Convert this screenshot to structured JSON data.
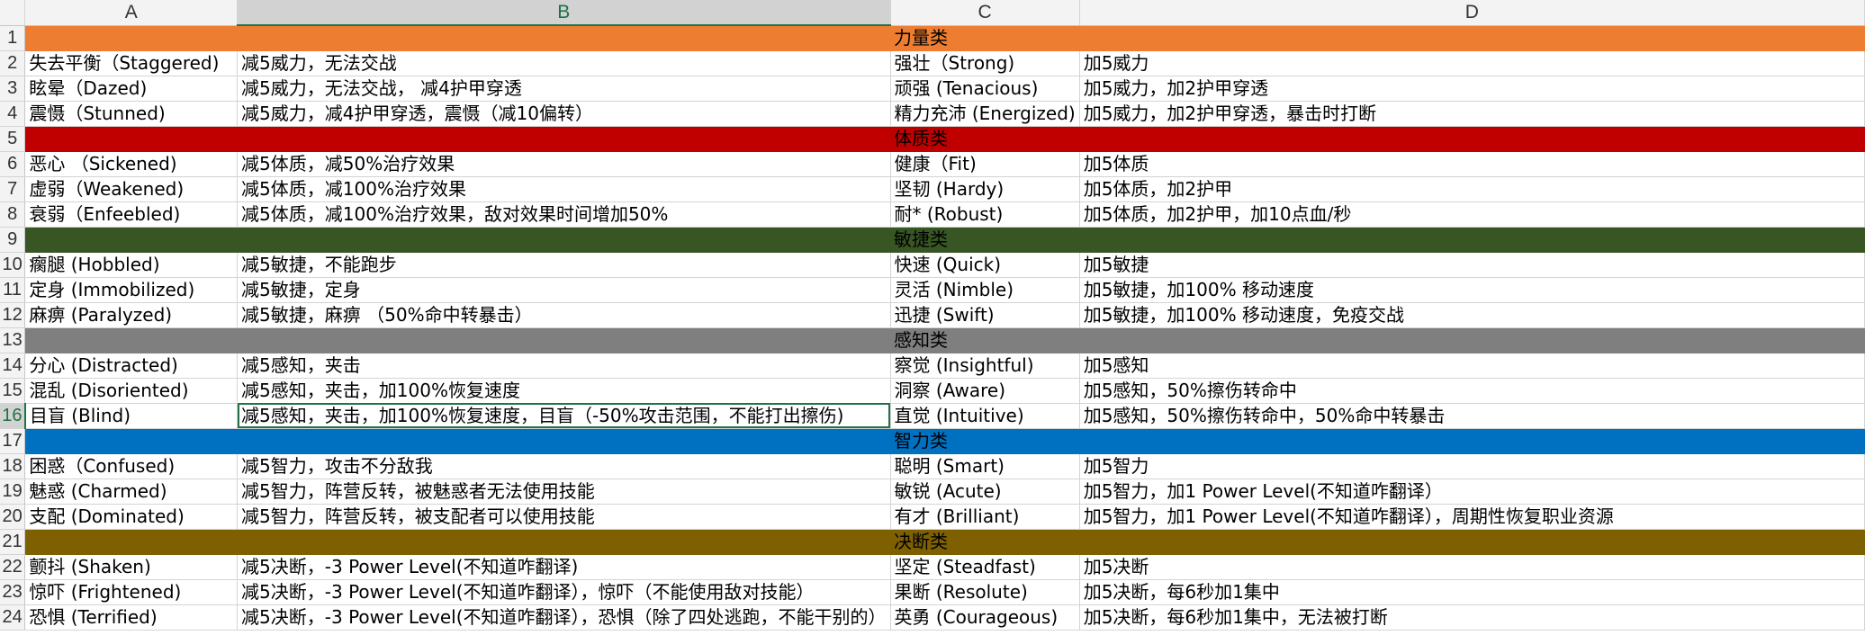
{
  "column_headers": [
    "A",
    "B",
    "C",
    "D"
  ],
  "selected_column": "B",
  "selected_row": "16",
  "colors": {
    "力量类": "#ed7d31",
    "体质类": "#c00000",
    "敏捷类": "#375623",
    "感知类": "#7f7f7f",
    "智力类": "#0070c0",
    "决断类": "#7f6000"
  },
  "rows": [
    {
      "n": "1",
      "band": true,
      "title": "力量类"
    },
    {
      "n": "2",
      "a": "失去平衡（Staggered)",
      "b": "减5威力，无法交战",
      "c": "强壮（Strong)",
      "d": "加5威力"
    },
    {
      "n": "3",
      "a": "眩晕（Dazed)",
      "b": "减5威力，无法交战， 减4护甲穿透",
      "c": "顽强 (Tenacious)",
      "d": "加5威力，加2护甲穿透"
    },
    {
      "n": "4",
      "a": "震慑（Stunned)",
      "b": "减5威力，减4护甲穿透，震慑（减10偏转）",
      "c": "精力充沛 (Energized)",
      "d": "加5威力，加2护甲穿透，暴击时打断"
    },
    {
      "n": "5",
      "band": true,
      "title": "体质类"
    },
    {
      "n": "6",
      "a": "恶心 （Sickened)",
      "b": "减5体质，减50%治疗效果",
      "c": "健康（Fit)",
      "d": "加5体质"
    },
    {
      "n": "7",
      "a": "虚弱（Weakened)",
      "b": "减5体质，减100%治疗效果",
      "c": "坚韧 (Hardy)",
      "d": "加5体质，加2护甲"
    },
    {
      "n": "8",
      "a": "衰弱（Enfeebled)",
      "b": "减5体质，减100%治疗效果，敌对效果时间增加50%",
      "c": "耐* (Robust)",
      "d": "加5体质，加2护甲，加10点血/秒"
    },
    {
      "n": "9",
      "band": true,
      "title": "敏捷类"
    },
    {
      "n": "10",
      "a": "瘸腿 (Hobbled)",
      "b": "减5敏捷，不能跑步",
      "c": "快速 (Quick)",
      "d": "加5敏捷"
    },
    {
      "n": "11",
      "a": "定身 (Immobilized)",
      "b": "减5敏捷，定身",
      "c": "灵活 (Nimble)",
      "d": "加5敏捷，加100% 移动速度"
    },
    {
      "n": "12",
      "a": "麻痹 (Paralyzed)",
      "b": "减5敏捷，麻痹 （50%命中转暴击）",
      "c": "迅捷 (Swift)",
      "d": "加5敏捷，加100% 移动速度，免疫交战"
    },
    {
      "n": "13",
      "band": true,
      "title": "感知类"
    },
    {
      "n": "14",
      "a": "分心 (Distracted)",
      "b": "减5感知，夹击",
      "c": "察觉 (Insightful)",
      "d": "加5感知"
    },
    {
      "n": "15",
      "a": "混乱 (Disoriented)",
      "b": "减5感知，夹击，加100%恢复速度",
      "c": "洞察 (Aware)",
      "d": "加5感知，50%擦伤转命中"
    },
    {
      "n": "16",
      "a": "目盲 (Blind)",
      "b": "减5感知，夹击，加100%恢复速度，目盲（-50%攻击范围，不能打出擦伤)",
      "c": "直觉 (Intuitive)",
      "d": "加5感知，50%擦伤转命中，50%命中转暴击"
    },
    {
      "n": "17",
      "band": true,
      "title": "智力类"
    },
    {
      "n": "18",
      "a": "困惑（Confused)",
      "b": "减5智力，攻击不分敌我",
      "c": "聪明 (Smart)",
      "d": "加5智力"
    },
    {
      "n": "19",
      "a": "魅惑 (Charmed)",
      "b": "减5智力，阵营反转，被魅惑者无法使用技能",
      "c": "敏锐 (Acute)",
      "d": "加5智力，加1 Power Level(不知道咋翻译）"
    },
    {
      "n": "20",
      "a": "支配 (Dominated)",
      "b": "减5智力，阵营反转，被支配者可以使用技能",
      "c": "有才 (Brilliant)",
      "d": "加5智力，加1 Power Level(不知道咋翻译），周期性恢复职业资源"
    },
    {
      "n": "21",
      "band": true,
      "title": "决断类"
    },
    {
      "n": "22",
      "a": "颤抖 (Shaken)",
      "b": "减5决断，-3 Power Level(不知道咋翻译)",
      "c": "坚定 (Steadfast)",
      "d": "加5决断"
    },
    {
      "n": "23",
      "a": "惊吓 (Frightened)",
      "b": "减5决断，-3 Power Level(不知道咋翻译），惊吓（不能使用敌对技能）",
      "c": "果断 (Resolute)",
      "d": "加5决断，每6秒加1集中"
    },
    {
      "n": "24",
      "a": "恐惧 (Terrified)",
      "b": "减5决断，-3 Power Level(不知道咋翻译），恐惧（除了四处逃跑，不能干别的）",
      "c": "英勇 (Courageous)",
      "d": "加5决断，每6秒加1集中，无法被打断"
    }
  ]
}
